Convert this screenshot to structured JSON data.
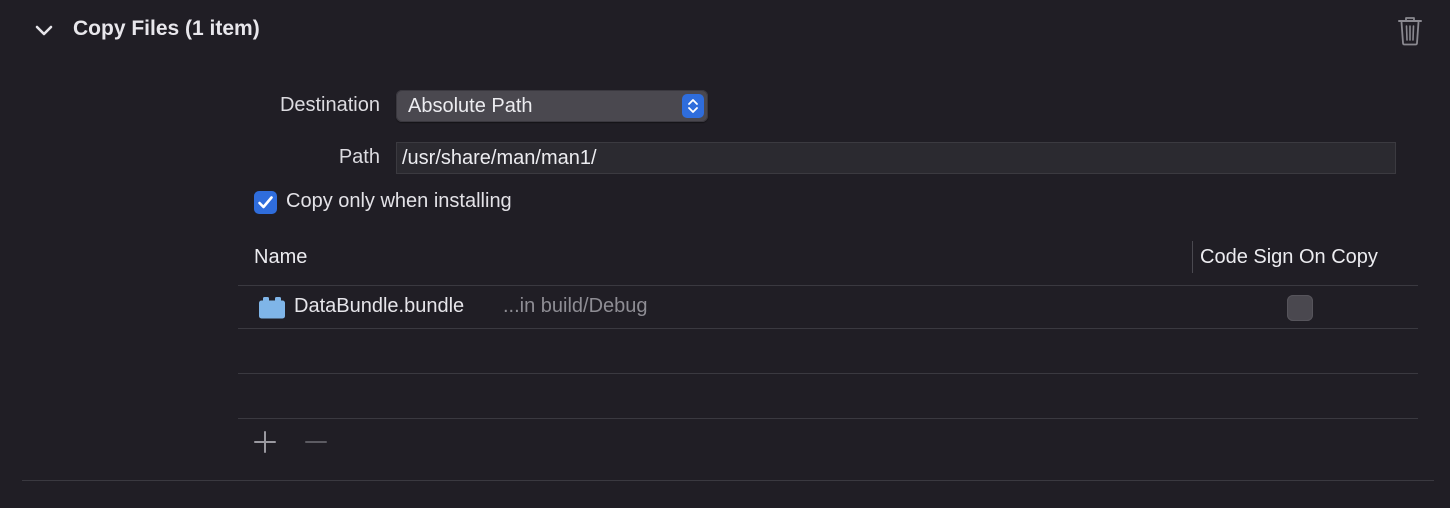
{
  "section": {
    "title": "Copy Files (1 item)",
    "icons": {
      "collapse": "chevron-down-icon",
      "delete": "trash-icon"
    }
  },
  "form": {
    "destination_label": "Destination",
    "destination_value": "Absolute Path",
    "path_label": "Path",
    "path_value": "/usr/share/man/man1/",
    "copy_only_label": "Copy only when installing",
    "copy_only_checked": true
  },
  "table": {
    "columns": [
      "Name",
      "Code Sign On Copy"
    ],
    "rows": [
      {
        "name": "DataBundle.bundle",
        "location": "...in build/Debug",
        "icon": "bundle-icon",
        "code_sign": false
      }
    ]
  },
  "toolbar": {
    "add_icon": "plus-icon",
    "remove_icon": "minus-icon"
  },
  "colors": {
    "background": "#201e25",
    "accent": "#2f6ddc",
    "bundle_icon": "#7fb5e8"
  }
}
